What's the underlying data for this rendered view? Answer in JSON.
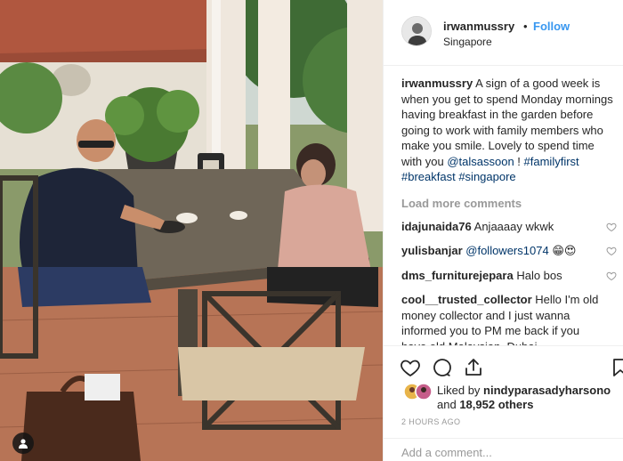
{
  "post": {
    "username": "irwanmussry",
    "separator": "•",
    "follow_label": "Follow",
    "location": "Singapore",
    "caption": {
      "username": "irwanmussry",
      "text": "A sign of a good week is when you get to spend Monday mornings having breakfast in the garden before going to work with family members who make you smile. Lovely to spend time with you",
      "mention": "@talsassoon",
      "after_mention": " ! ",
      "hashtags": [
        "#familyfirst",
        "#breakfast",
        "#singapore"
      ]
    },
    "load_more_label": "Load more comments",
    "comments": [
      {
        "username": "idajunaida76",
        "text": "Anjaaaay wkwk"
      },
      {
        "username": "yulisbanjar",
        "mention": "@followers1074",
        "text": "😁😍"
      },
      {
        "username": "dms_furniturejepara",
        "text": "Halo bos"
      },
      {
        "username": "cool__trusted_collector",
        "text": "Hello I'm old money collector and I just wanna informed you to PM me back if you have old Malaysian, Dubai, UAE,Singapore,Brunei,China coin,old juries,old lamp or note for sale!!!! The"
      }
    ],
    "likes": {
      "prefix": "Liked by",
      "user": "nindyparasadyharsono",
      "and": "and",
      "count": "18,952 others"
    },
    "timestamp": "2 HOURS AGO",
    "add_comment_placeholder": "Add a comment..."
  },
  "icons": {
    "like": "heart-icon",
    "comment": "comment-icon",
    "share": "share-icon",
    "save": "bookmark-icon",
    "user_tag": "user-tag-icon"
  },
  "colors": {
    "link": "#3897f0",
    "hashtag": "#003569",
    "muted": "#999999",
    "text": "#262626"
  }
}
